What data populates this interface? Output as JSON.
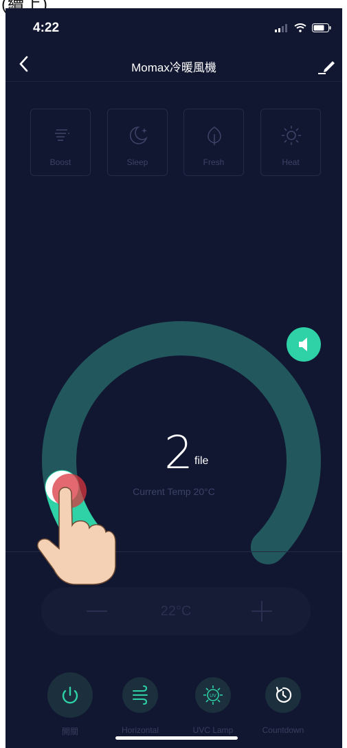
{
  "caption": "(續上)",
  "status": {
    "time": "4:22"
  },
  "header": {
    "title": "Momax冷暖風機"
  },
  "modes": [
    {
      "label": "Boost",
      "icon": "boost-icon"
    },
    {
      "label": "Sleep",
      "icon": "moon-icon"
    },
    {
      "label": "Fresh",
      "icon": "leaf-icon"
    },
    {
      "label": "Heat",
      "icon": "sun-icon"
    }
  ],
  "dial": {
    "value": "2",
    "unit": "file",
    "current_temp": "Current Temp 20°C",
    "level_fraction": 0.12,
    "colors": {
      "track": "#22585d",
      "fill": "#2fd1a6"
    }
  },
  "temp_control": {
    "value": "22°C"
  },
  "controls": [
    {
      "label": "開關",
      "icon": "power-icon"
    },
    {
      "label": "Horizontal",
      "icon": "wind-icon"
    },
    {
      "label": "UVC Lamp",
      "icon": "uv-lamp-icon"
    },
    {
      "label": "Countdown",
      "icon": "timer-icon"
    }
  ],
  "accent": "#2fd1a6"
}
